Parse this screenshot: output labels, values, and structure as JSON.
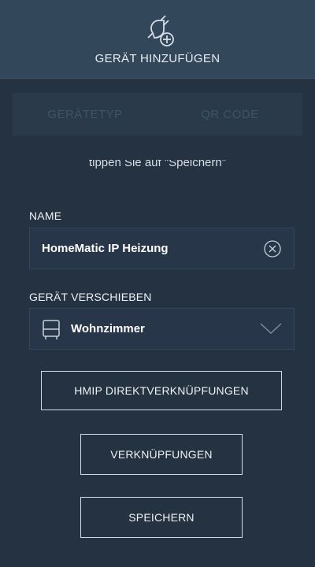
{
  "header": {
    "title": "GERÄT HINZUFÜGEN",
    "icon": "plug-plus-icon"
  },
  "tabs": [
    {
      "label": "GERÄTETYP"
    },
    {
      "label": "QR CODE"
    }
  ],
  "hint": "tippen Sie auf \"Speichern\"",
  "name_field": {
    "label": "NAME",
    "value": "HomeMatic IP Heizung",
    "clear_icon": "clear-circle-icon"
  },
  "move_field": {
    "label": "GERÄT VERSCHIEBEN",
    "value": "Wohnzimmer",
    "icon": "sofa-icon"
  },
  "buttons": {
    "direct_links": "HMIP DIREKTVERKNÜPFUNGEN",
    "links": "VERKNÜPFUNGEN",
    "save": "SPEICHERN"
  },
  "colors": {
    "background": "#243241",
    "header": "#33475b",
    "tab_bar": "#2a3a4b",
    "text": "#ffffff"
  }
}
